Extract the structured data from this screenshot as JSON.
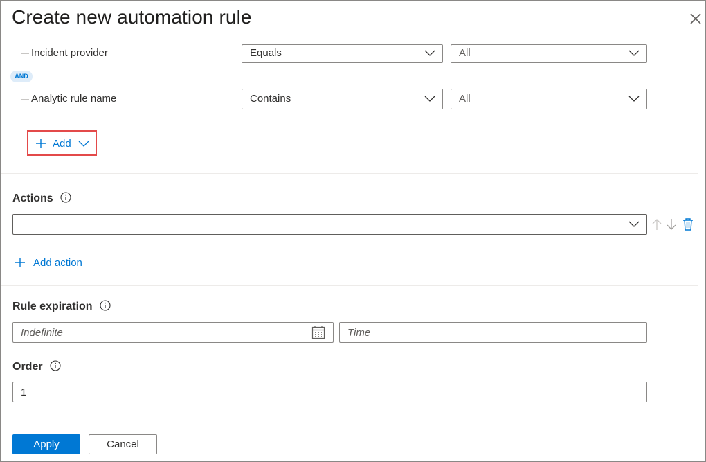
{
  "dialog": {
    "title": "Create new automation rule"
  },
  "conditions": {
    "operator_badge": "AND",
    "rows": [
      {
        "property": "Incident provider",
        "operator": "Equals",
        "value": "All"
      },
      {
        "property": "Analytic rule name",
        "operator": "Contains",
        "value": "All"
      }
    ],
    "add_label": "Add"
  },
  "actions": {
    "heading": "Actions",
    "selected": "",
    "add_action_label": "Add action"
  },
  "rule_expiration": {
    "heading": "Rule expiration",
    "date_placeholder": "Indefinite",
    "time_placeholder": "Time"
  },
  "order": {
    "heading": "Order",
    "value": "1"
  },
  "footer": {
    "apply_label": "Apply",
    "cancel_label": "Cancel"
  },
  "colors": {
    "accent": "#0078d4",
    "highlight": "#e34a4a",
    "border": "#8a8886"
  },
  "icons": [
    "close-icon",
    "chevron-down-icon",
    "info-icon",
    "plus-icon",
    "arrow-up-icon",
    "arrow-down-icon",
    "delete-icon",
    "calendar-icon"
  ]
}
